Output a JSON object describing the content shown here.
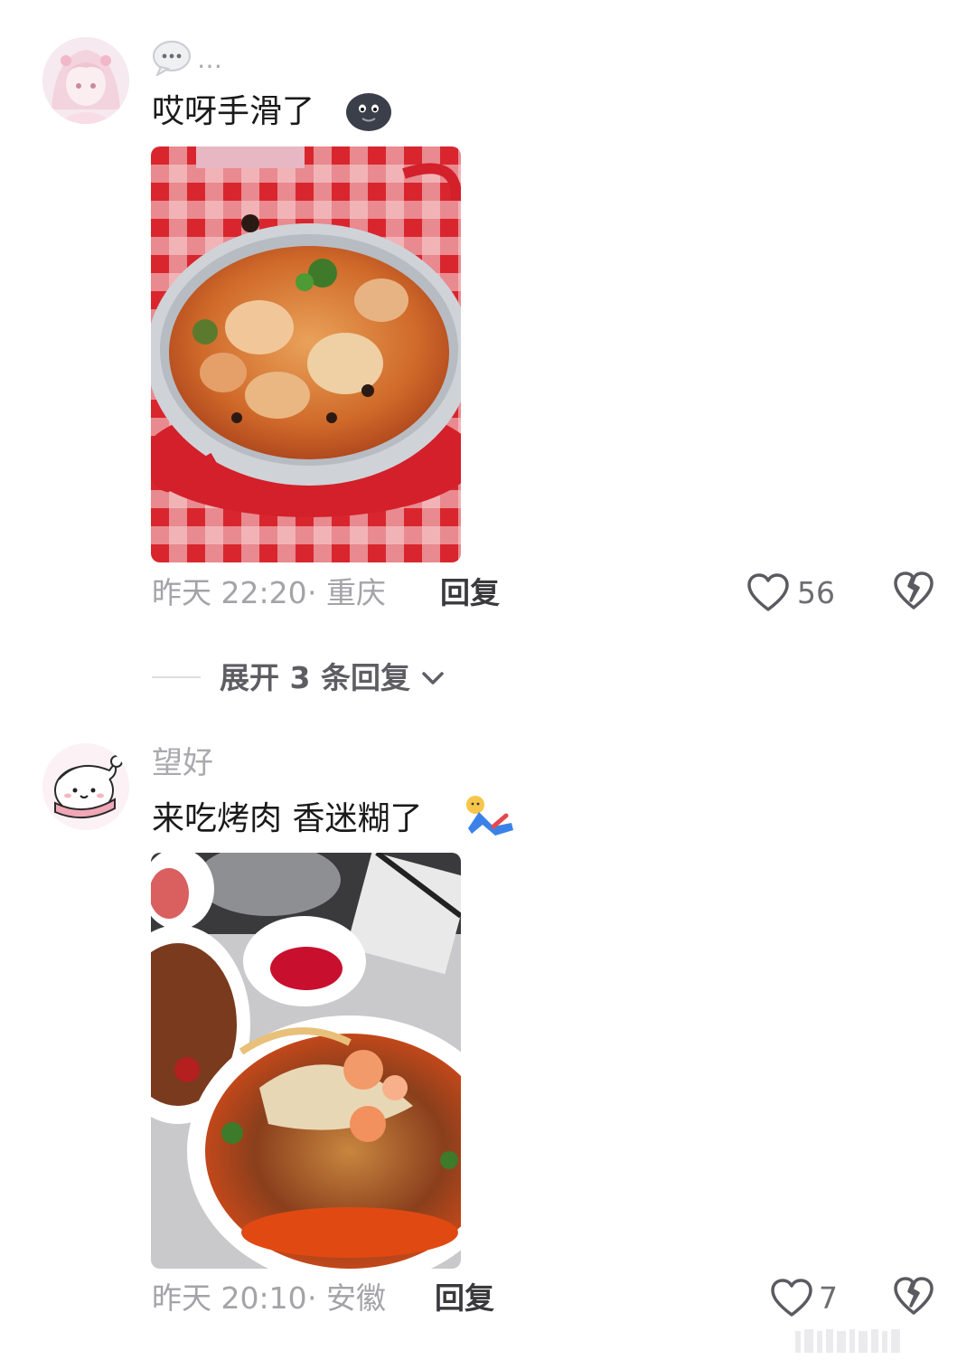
{
  "comments": [
    {
      "username": "…",
      "text": "哎呀手滑了",
      "emoji_icon": "dark-smiling-face-emoji",
      "time": "昨天 22:20",
      "location": "· 重庆",
      "reply_label": "回复",
      "likes": "56"
    },
    {
      "username": "望好",
      "text": "来吃烤肉 香迷糊了",
      "emoji_icon": "dizzy-falling-person-emoji",
      "time": "昨天 20:10",
      "location": "· 安徽",
      "reply_label": "回复",
      "likes": "7"
    }
  ],
  "expand_replies": {
    "label": "展开 3 条回复"
  },
  "watermark": "微博"
}
